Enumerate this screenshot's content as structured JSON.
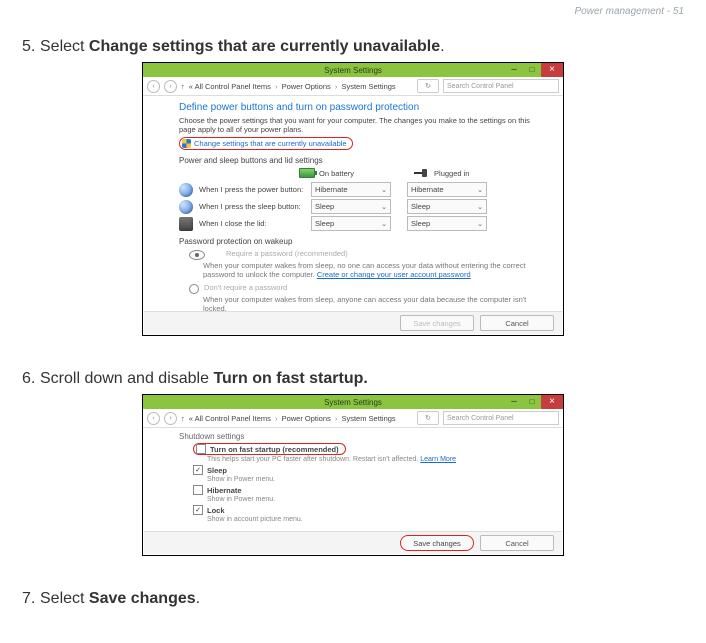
{
  "page_header": "Power management - 51",
  "steps": {
    "s5": {
      "num": "5.",
      "text_pre": "Select ",
      "text_bold": "Change settings that are currently unavailable",
      "text_post": "."
    },
    "s6": {
      "num": "6.",
      "text_pre": "Scroll down and disable ",
      "text_bold": "Turn on fast startup.",
      "text_post": ""
    },
    "s7": {
      "num": "7.",
      "text_pre": "Select ",
      "text_bold": "Save changes",
      "text_post": "."
    }
  },
  "win": {
    "title": "System Settings",
    "search_placeholder": "Search Control Panel",
    "breadcrumb": {
      "root_icon": "↑",
      "sep": "›",
      "items": [
        "All Control Panel Items",
        "Power Options",
        "System Settings"
      ]
    },
    "refresh_label": "↻"
  },
  "panel1": {
    "heading": "Define power buttons and turn on password protection",
    "desc": "Choose the power settings that you want for your computer. The changes you make to the settings on this page apply to all of your power plans.",
    "change_link": "Change settings that are currently unavailable",
    "buttons_section": "Power and sleep buttons and lid settings",
    "col_battery": "On battery",
    "col_plugged": "Plugged in",
    "rows": [
      {
        "label": "When I press the power button:",
        "battery": "Hibernate",
        "plugged": "Hibernate"
      },
      {
        "label": "When I press the sleep button:",
        "battery": "Sleep",
        "plugged": "Sleep"
      },
      {
        "label": "When I close the lid:",
        "battery": "Sleep",
        "plugged": "Sleep"
      }
    ],
    "pw_section": "Password protection on wakeup",
    "pw_req": {
      "label": "Require a password (recommended)",
      "help": "When your computer wakes from sleep, no one can access your data without entering the correct password to unlock the computer. ",
      "link": "Create or change your user account password"
    },
    "pw_noreq": {
      "label": "Don't require a password",
      "help": "When your computer wakes from sleep, anyone can access your data because the computer isn't locked."
    },
    "save": "Save changes",
    "cancel": "Cancel"
  },
  "panel2": {
    "section": "Shutdown settings",
    "fast": {
      "label": "Turn on fast startup (recommended)",
      "sub": "This helps start your PC faster after shutdown. Restart isn't affected. ",
      "link": "Learn More"
    },
    "sleep": {
      "label": "Sleep",
      "sub": "Show in Power menu."
    },
    "hibernate": {
      "label": "Hibernate",
      "sub": "Show in Power menu."
    },
    "lock": {
      "label": "Lock",
      "sub": "Show in account picture menu."
    },
    "save": "Save changes",
    "cancel": "Cancel"
  }
}
